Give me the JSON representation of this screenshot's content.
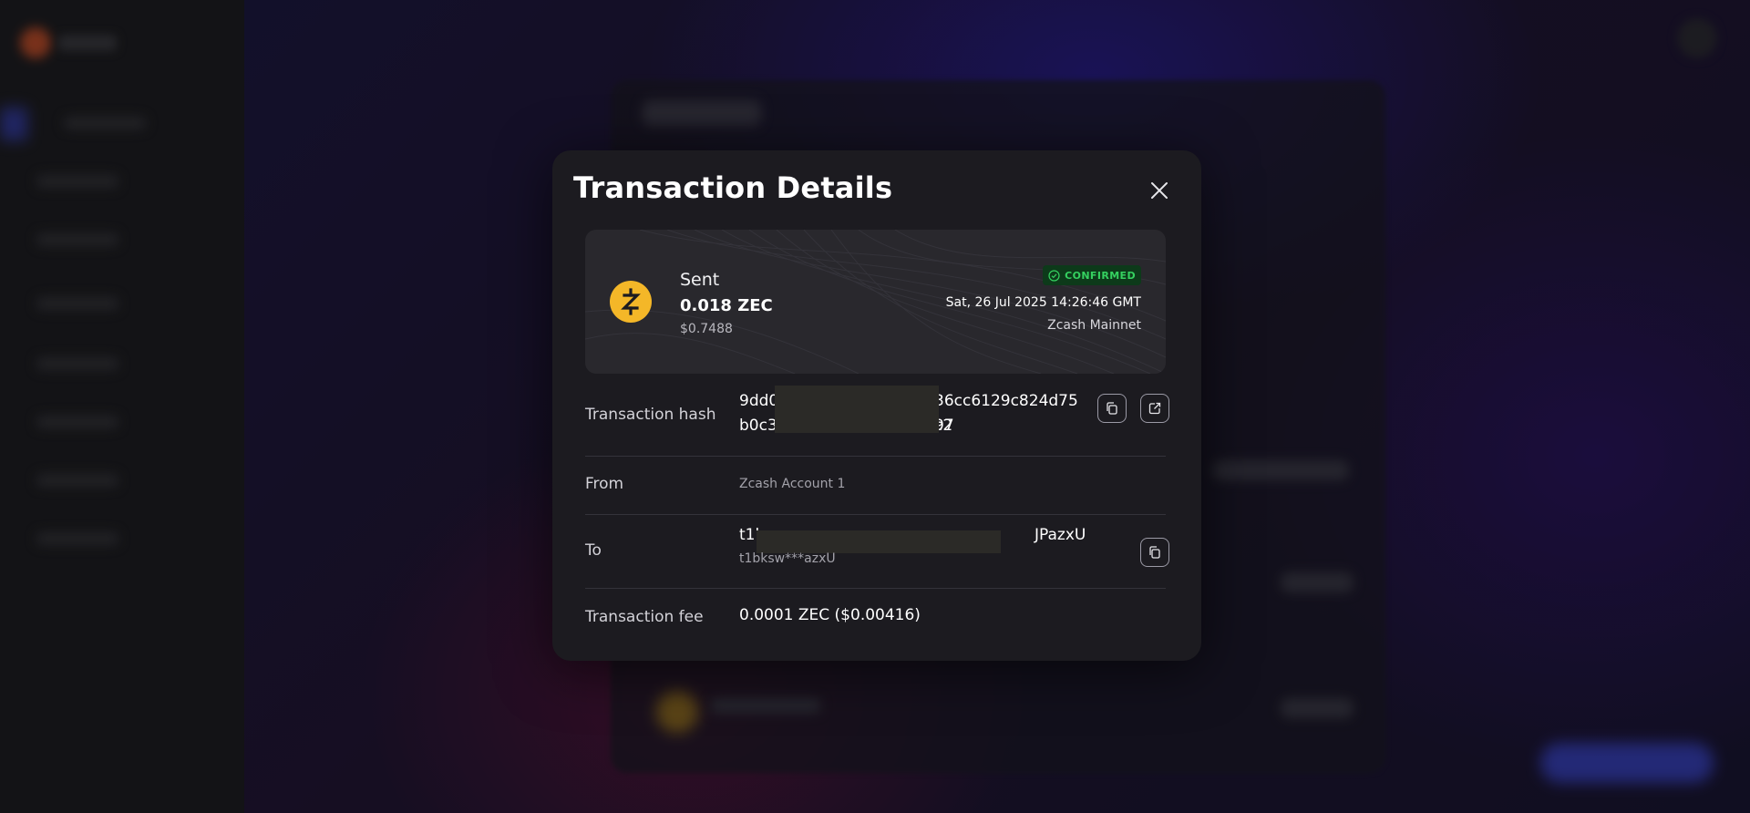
{
  "modal": {
    "title": "Transaction Details"
  },
  "summary": {
    "type": "Sent",
    "amount": "0.018 ZEC",
    "usd_value": "$0.7488",
    "status": "CONFIRMED",
    "date": "Sat, 26 Jul 2025 14:26:46 GMT",
    "network": "Zcash Mainnet",
    "coin_icon": "zcash-icon"
  },
  "details": {
    "hash_label": "Transaction hash",
    "hash_line1_start": "9dd0",
    "hash_line1_end": "36cc6129c824d75c2",
    "hash_line2_start": "b0c3",
    "hash_line2_end": "97",
    "from_label": "From",
    "from_value": "Zcash Account 1",
    "to_label": "To",
    "to_address_start": "t1b",
    "to_address_end": "JPazxU",
    "to_short": "t1bksw***azxU",
    "fee_label": "Transaction fee",
    "fee_value": "0.0001 ZEC ($0.00416)"
  },
  "colors": {
    "confirmed": "#35d160",
    "zec": "#f4b728"
  }
}
